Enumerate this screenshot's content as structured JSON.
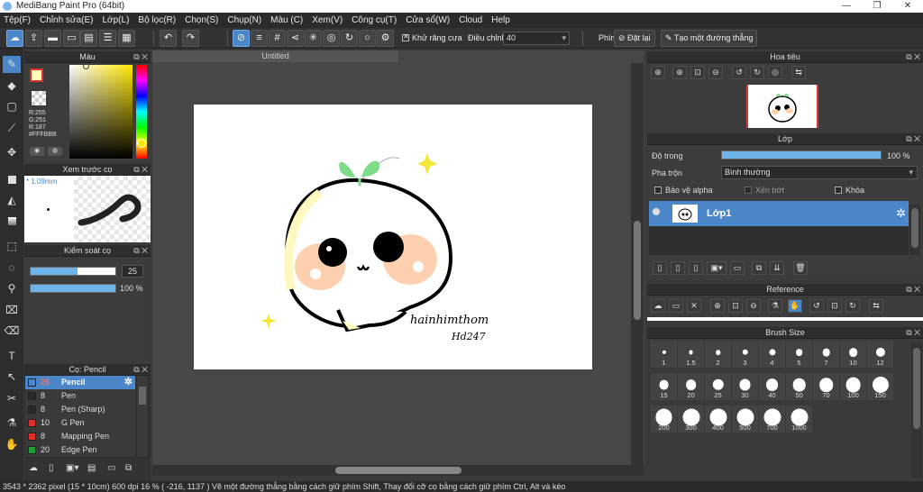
{
  "window": {
    "title": "MediBang Paint Pro (64bit)",
    "controls": [
      "—",
      "❐",
      "✕"
    ]
  },
  "menu": [
    "Tệp(F)",
    "Chỉnh sửa(E)",
    "Lớp(L)",
    "Bộ lọc(R)",
    "Chọn(S)",
    "Chụp(N)",
    "Màu (C)",
    "Xem(V)",
    "Công cụ(T)",
    "Cửa sổ(W)",
    "Cloud",
    "Help"
  ],
  "toolbar": {
    "antialias_label": "Khử răng cưa",
    "antialias_checked": true,
    "adjust_label": "Điều chỉnh",
    "adjust_value": "40",
    "key_label": "Phím",
    "reset_label": "Đặt lại",
    "line_label": "Tạo một đường thẳng"
  },
  "color_panel": {
    "title": "Màu",
    "rgb": [
      "R:255",
      "G:251",
      "R:187"
    ],
    "hex": "#FFFBBB",
    "fg_color": "#fffbbb"
  },
  "preview_panel": {
    "title": "Xem trước cọ",
    "size": "1.09mm"
  },
  "brush_control": {
    "title": "Kiểm soát cọ",
    "size_value": "25",
    "opacity_value": "100 %",
    "size_fraction": 0.55,
    "opacity_fraction": 1.0
  },
  "brush_panel": {
    "title": "Cọ: Pencil",
    "items": [
      {
        "size": "25",
        "name": "Pencil",
        "color": "#4a86c8"
      },
      {
        "size": "8",
        "name": "Pen",
        "color": "#2a2a2a"
      },
      {
        "size": "8",
        "name": "Pen (Sharp)",
        "color": "#2a2a2a"
      },
      {
        "size": "10",
        "name": "G Pen",
        "color": "#e0302a"
      },
      {
        "size": "8",
        "name": "Mapping Pen",
        "color": "#e0302a"
      },
      {
        "size": "20",
        "name": "Edge Pen",
        "color": "#1f9e3a"
      }
    ]
  },
  "canvas": {
    "tab_title": "Untitled",
    "signature_line1": "hainhimthom",
    "signature_line2": "Hd247"
  },
  "navigator": {
    "title": "Hoa tiêu"
  },
  "layer_panel": {
    "title": "Lớp",
    "opacity_label": "Độ trong",
    "opacity_value": "100 %",
    "opacity_fraction": 1.0,
    "blend_label": "Pha trộn",
    "blend_value": "Bình thường",
    "protect_alpha": "Bảo vệ alpha",
    "clipping": "Xén bớt",
    "lock": "Khóa",
    "layer_name": "Lớp1"
  },
  "reference_panel": {
    "title": "Reference"
  },
  "brush_size_panel": {
    "title": "Brush Size",
    "sizes": [
      "1",
      "1.5",
      "2",
      "3",
      "4",
      "5",
      "7",
      "10",
      "12",
      "15",
      "20",
      "25",
      "30",
      "40",
      "50",
      "70",
      "100",
      "150",
      "200",
      "300",
      "400",
      "500",
      "700",
      "1000"
    ]
  },
  "status": "3543 * 2362 pixel   (15 * 10cm)   600 dpi   16 %   ( -216, 1137 )   Vẽ một đường thẳng bằng cách giữ phím Shift, Thay đổi cỡ cọ bằng cách giữ phím Ctrl, Alt và kéo"
}
